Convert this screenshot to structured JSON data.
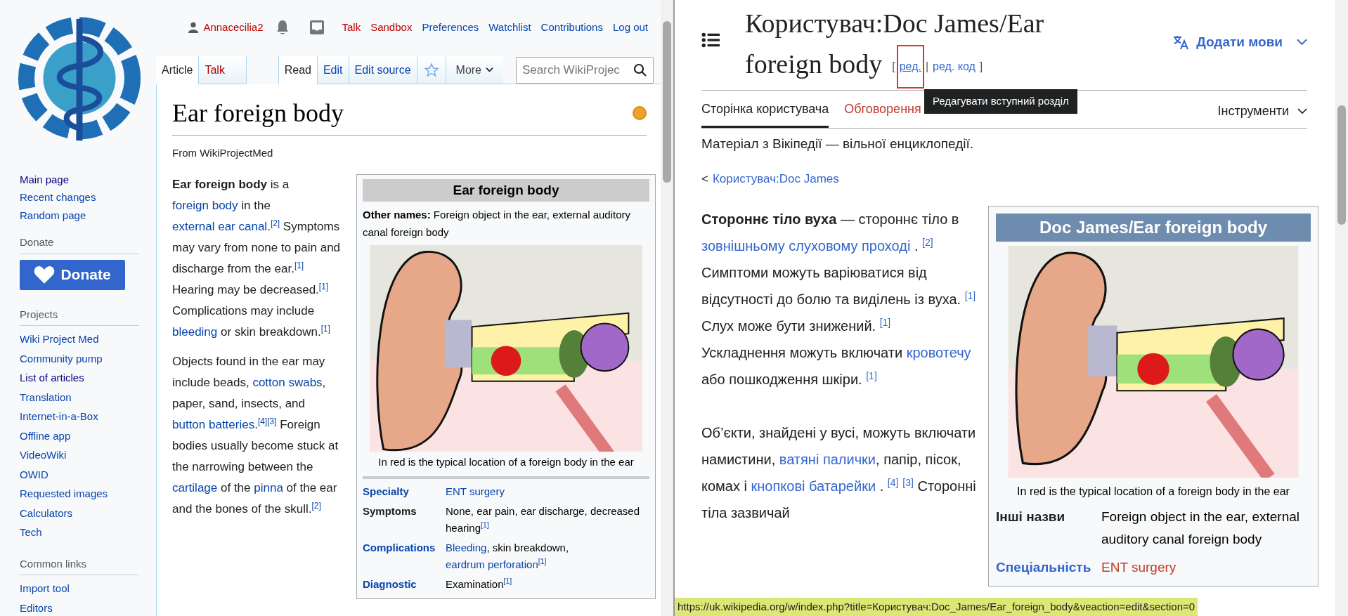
{
  "left_window": {
    "sidebar": {
      "nav": [
        {
          "label": "Main page",
          "visited": true
        },
        {
          "label": "Recent changes",
          "visited": false
        },
        {
          "label": "Random page",
          "visited": false
        }
      ],
      "donate_heading": "Donate",
      "donate_button": "Donate",
      "projects_heading": "Projects",
      "projects": [
        {
          "label": "Wiki Project Med",
          "visited": false
        },
        {
          "label": "Community pump",
          "visited": false
        },
        {
          "label": "List of articles",
          "visited": true
        },
        {
          "label": "Translation",
          "visited": false
        },
        {
          "label": "Internet-in-a-Box",
          "visited": false
        },
        {
          "label": "Offline app",
          "visited": false
        },
        {
          "label": "VideoWiki",
          "visited": false
        },
        {
          "label": "OWID",
          "visited": false
        },
        {
          "label": "Requested images",
          "visited": false
        },
        {
          "label": "Calculators",
          "visited": false
        },
        {
          "label": "Tech",
          "visited": false
        }
      ],
      "common_heading": "Common links",
      "common": [
        {
          "label": "Import tool",
          "visited": false
        },
        {
          "label": "Editors",
          "visited": false
        }
      ]
    },
    "personal_tools": [
      {
        "kind": "user",
        "label": "Annacecilia2",
        "missing": true
      },
      {
        "kind": "alerts"
      },
      {
        "kind": "notices"
      },
      {
        "kind": "link",
        "label": "Talk",
        "missing": true
      },
      {
        "kind": "link",
        "label": "Sandbox",
        "missing": true
      },
      {
        "kind": "link",
        "label": "Preferences",
        "missing": false
      },
      {
        "kind": "link",
        "label": "Watchlist",
        "missing": false
      },
      {
        "kind": "link",
        "label": "Contributions",
        "missing": false
      },
      {
        "kind": "link",
        "label": "Log out",
        "missing": false
      }
    ],
    "namespaces": [
      {
        "label": "Article",
        "selected": true,
        "missing": false
      },
      {
        "label": "Talk",
        "selected": false,
        "missing": true
      }
    ],
    "views": [
      {
        "kind": "tab",
        "label": "Read",
        "selected": true
      },
      {
        "kind": "tab",
        "label": "Edit",
        "selected": false
      },
      {
        "kind": "tab",
        "label": "Edit source",
        "selected": false
      },
      {
        "kind": "watch",
        "watched": false
      },
      {
        "kind": "menu",
        "label": "More"
      }
    ],
    "search": {
      "placeholder": "Search WikiProjec"
    },
    "title": "Ear foreign body",
    "tagline": "From WikiProjectMed",
    "paragraphs": [
      [
        {
          "kind": "bold",
          "text": "Ear foreign body"
        },
        {
          "kind": "plain",
          "text": " is a "
        },
        {
          "kind": "link",
          "text": "foreign body"
        },
        {
          "kind": "plain",
          "text": " in the "
        },
        {
          "kind": "link",
          "text": "external ear canal"
        },
        {
          "kind": "plain",
          "text": "."
        },
        {
          "kind": "ref",
          "text": "[2]"
        },
        {
          "kind": "plain",
          "text": " Symptoms may vary from none to pain and discharge from the ear."
        },
        {
          "kind": "ref",
          "text": "[1]"
        },
        {
          "kind": "plain",
          "text": " Hearing may be decreased."
        },
        {
          "kind": "ref",
          "text": "[1]"
        },
        {
          "kind": "plain",
          "text": " Complications may include "
        },
        {
          "kind": "link",
          "text": "bleeding"
        },
        {
          "kind": "plain",
          "text": " or skin breakdown."
        },
        {
          "kind": "ref",
          "text": "[1]"
        }
      ],
      [
        {
          "kind": "plain",
          "text": "Objects found in the ear may include beads, "
        },
        {
          "kind": "link",
          "text": "cotton swabs"
        },
        {
          "kind": "plain",
          "text": ", paper, sand, insects, and "
        },
        {
          "kind": "link",
          "text": "button batteries"
        },
        {
          "kind": "plain",
          "text": "."
        },
        {
          "kind": "ref",
          "text": "[4]"
        },
        {
          "kind": "ref",
          "text": "[3]"
        },
        {
          "kind": "plain",
          "text": " Foreign bodies usually become stuck at the narrowing between the "
        },
        {
          "kind": "link",
          "text": "cartilage"
        },
        {
          "kind": "plain",
          "text": " of the "
        },
        {
          "kind": "link",
          "text": "pinna"
        },
        {
          "kind": "plain",
          "text": " of the ear and the bones of the skull."
        },
        {
          "kind": "ref",
          "text": "[2]"
        }
      ]
    ],
    "infobox": {
      "title": "Ear foreign body",
      "other_names_label": "Other names:",
      "other_names": "Foreign object in the ear, external auditory canal foreign body",
      "caption": "In red is the typical location of a foreign body in the ear",
      "rows": [
        {
          "label": "Specialty",
          "label_link": true,
          "value": [
            {
              "kind": "link",
              "text": "ENT surgery"
            }
          ]
        },
        {
          "label": "Symptoms",
          "label_link": false,
          "value": [
            {
              "kind": "plain",
              "text": "None, ear pain, ear discharge, decreased hearing"
            },
            {
              "kind": "ref",
              "text": "[1]"
            }
          ]
        },
        {
          "label": "Complications",
          "label_link": true,
          "value": [
            {
              "kind": "link",
              "text": "Bleeding"
            },
            {
              "kind": "plain",
              "text": ", skin breakdown, "
            },
            {
              "kind": "link",
              "text": "eardrum perforation"
            },
            {
              "kind": "ref",
              "text": "[1]"
            }
          ]
        },
        {
          "label": "Diagnostic",
          "label_link": true,
          "value": [
            {
              "kind": "plain",
              "text": "Examination"
            },
            {
              "kind": "ref",
              "text": "[1]"
            }
          ]
        }
      ]
    }
  },
  "right_window": {
    "title": "Користувач:Doc James/Ear foreign body",
    "section_edit": {
      "open": "[",
      "separator": "|",
      "close": "]",
      "links": [
        {
          "label": "ред.",
          "focused": true
        },
        {
          "label": "ред. код",
          "focused": false
        }
      ]
    },
    "tooltip": "Редагувати вступний розділ",
    "language_button": "Додати мови",
    "tabs": [
      {
        "label": "Сторінка користувача",
        "selected": true,
        "missing": false
      },
      {
        "label": "Обговорення",
        "selected": false,
        "missing": true
      }
    ],
    "tools_menu": "Інструменти",
    "tagline": "Матеріал з Вікіпедії — вільної енциклопедії.",
    "parent_prefix": "<",
    "parent_link": "Користувач:Doc James",
    "paragraphs": [
      [
        {
          "kind": "bold",
          "text": "Стороннє тіло вуха"
        },
        {
          "kind": "plain",
          "text": " — стороннє тіло в "
        },
        {
          "kind": "link",
          "text": "зовнішньому слуховому проході"
        },
        {
          "kind": "plain",
          "text": " . "
        },
        {
          "kind": "ref",
          "text": "[2]"
        },
        {
          "kind": "plain",
          "text": " Симптоми можуть варіюватися від відсутності до болю та виділень із вуха. "
        },
        {
          "kind": "ref",
          "text": "[1]"
        },
        {
          "kind": "plain",
          "text": " Слух може бути знижений. "
        },
        {
          "kind": "ref",
          "text": "[1]"
        },
        {
          "kind": "plain",
          "text": " Ускладнення можуть включати "
        },
        {
          "kind": "link",
          "text": "кровотечу"
        },
        {
          "kind": "plain",
          "text": " або пошкодження шкіри. "
        },
        {
          "kind": "ref",
          "text": "[1]"
        }
      ],
      [
        {
          "kind": "plain",
          "text": "Об’єкти, знайдені у вусі, можуть включати намистини, "
        },
        {
          "kind": "link",
          "text": "ватяні палички"
        },
        {
          "kind": "plain",
          "text": ", папір, пісок, комах і "
        },
        {
          "kind": "link",
          "text": "кнопкові батарейки"
        },
        {
          "kind": "plain",
          "text": " . "
        },
        {
          "kind": "ref",
          "text": "[4]"
        },
        {
          "kind": "spaced_ref",
          "text": "[3]"
        },
        {
          "kind": "plain",
          "text": " Сторонні тіла зазвичай"
        }
      ]
    ],
    "infobox": {
      "title": "Doc James/Ear foreign body",
      "caption": "In red is the typical location of a foreign body in the ear",
      "rows": [
        {
          "label": "Інші назви",
          "label_link": false,
          "value": [
            {
              "kind": "plain",
              "text": "Foreign object in the ear, external auditory canal foreign body"
            }
          ]
        },
        {
          "label": "Спеціальність",
          "label_link": true,
          "value": [
            {
              "kind": "missing_link",
              "text": "ENT surgery"
            }
          ]
        }
      ]
    },
    "status_url": "https://uk.wikipedia.org/w/index.php?title=Користувач:Doc_James/Ear_foreign_body&veaction=edit&section=0"
  }
}
